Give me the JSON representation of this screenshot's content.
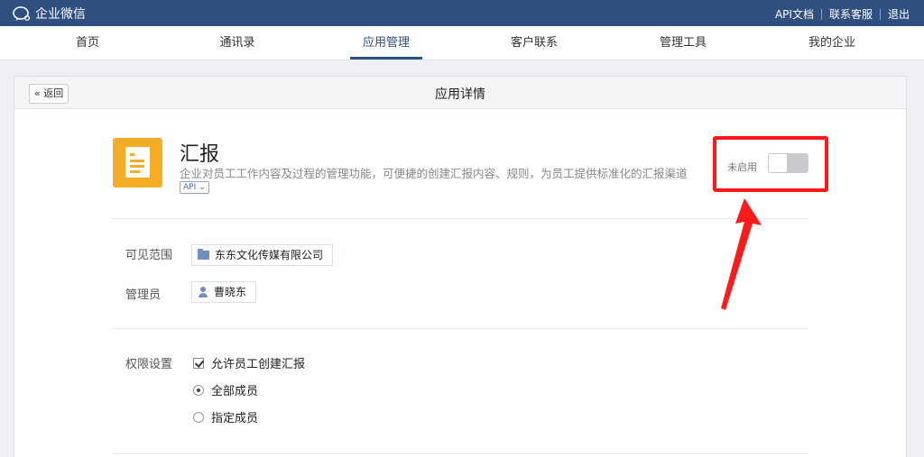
{
  "topbar": {
    "logo_text": "企业微信",
    "links": [
      "API文档",
      "联系客服",
      "退出"
    ]
  },
  "nav": {
    "items": [
      "首页",
      "通讯录",
      "应用管理",
      "客户联系",
      "管理工具",
      "我的企业"
    ],
    "active_index": 2
  },
  "header": {
    "back_label": "« 返回",
    "title": "应用详情"
  },
  "app": {
    "name": "汇报",
    "description": "企业对员工工作内容及过程的管理功能，可便捷的创建汇报内容、规则，为员工提供标准化的汇报渠道",
    "api_badge": "API ⌄",
    "icon": "report-document-icon",
    "status_label": "未启用",
    "enabled": false
  },
  "visibility": {
    "label": "可见范围",
    "value": "东东文化传媒有限公司",
    "icon": "folder-icon"
  },
  "admin": {
    "label": "管理员",
    "value": "曹晓东",
    "icon": "user-icon"
  },
  "permissions": {
    "label": "权限设置",
    "checkbox_label": "允许员工创建汇报",
    "checkbox_checked": true,
    "radio_options": [
      "全部成员",
      "指定成员"
    ],
    "radio_selected": 0
  },
  "colors": {
    "topbar": "#2e4f80",
    "app_icon": "#f5ad25",
    "highlight": "#ff1a1a"
  }
}
